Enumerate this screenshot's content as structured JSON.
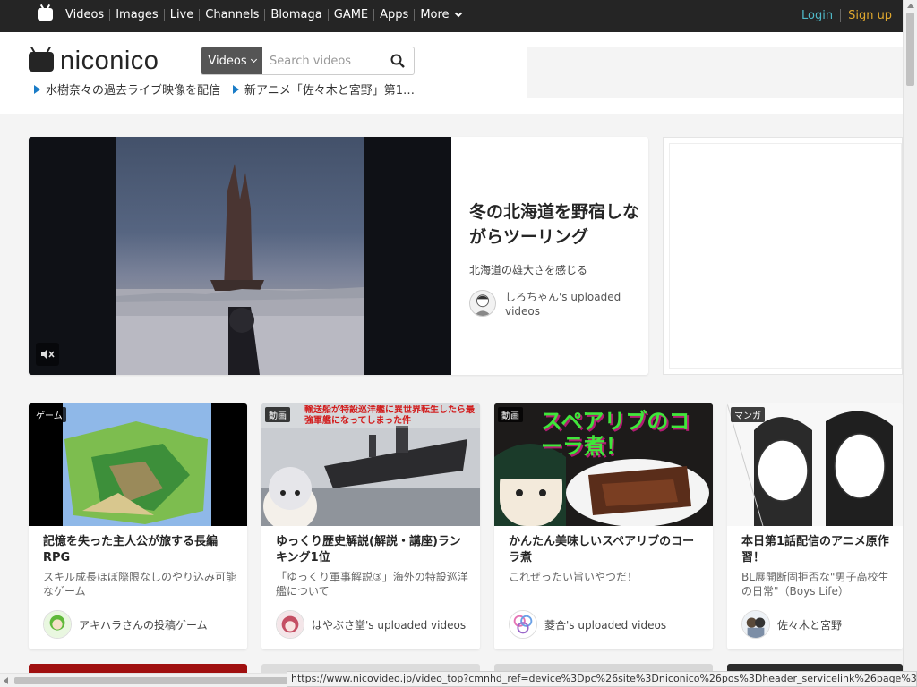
{
  "topnav": {
    "links": [
      "Videos",
      "Images",
      "Live",
      "Channels",
      "Blomaga",
      "GAME",
      "Apps"
    ],
    "more": "More",
    "login": "Login",
    "signup": "Sign up"
  },
  "header": {
    "logo": "niconico",
    "search": {
      "scope": "Videos",
      "placeholder": "Search videos"
    },
    "tickers": [
      "水樹奈々の過去ライブ映像を配信",
      "新アニメ「佐々木と宮野」第1…"
    ]
  },
  "hero": {
    "title": "冬の北海道を野宿しながらツーリング",
    "subtitle": "北海道の雄大さを感じる",
    "owner": "しろちゃん's uploaded videos"
  },
  "cards": [
    {
      "badge": "ゲーム",
      "title": "記憶を失った主人公が旅する長編RPG",
      "desc": "スキル成長ほぼ際限なしのやり込み可能なゲーム",
      "owner": "アキハラさんの投稿ゲーム"
    },
    {
      "badge": "動画",
      "overlay": "輸送船が特設巡洋艦に異世界転生したら最強軍艦になってしまった件",
      "title": "ゆっくり歴史解説(解説・講座)ランキング1位",
      "desc": "「ゆっくり軍事解説③」海外の特設巡洋艦について",
      "owner": "はやぶさ堂's uploaded videos"
    },
    {
      "badge": "動画",
      "overlay": "スペアリブのコーラ煮！",
      "title": "かんたん美味しいスペアリブのコーラ煮",
      "desc": "これぜったい旨いやつだ！",
      "owner": "菱合's uploaded videos"
    },
    {
      "badge": "マンガ",
      "title": "本日第1話配信のアニメ原作習！",
      "desc": "BL展開断固拒否な\"男子高校生の日常\"（Boys Life）",
      "owner": "佐々木と宮野"
    }
  ],
  "status_url": "https://www.nicovideo.jp/video_top?cmnhd_ref=device%3Dpc%26site%3Dniconico%26pos%3Dheader_servicelink%26page%3Dtop",
  "colors": {
    "topbar": "#252525",
    "login": "#4fb9c8",
    "signup": "#e0a82e",
    "ticker_arrow": "#1a7cc7"
  }
}
